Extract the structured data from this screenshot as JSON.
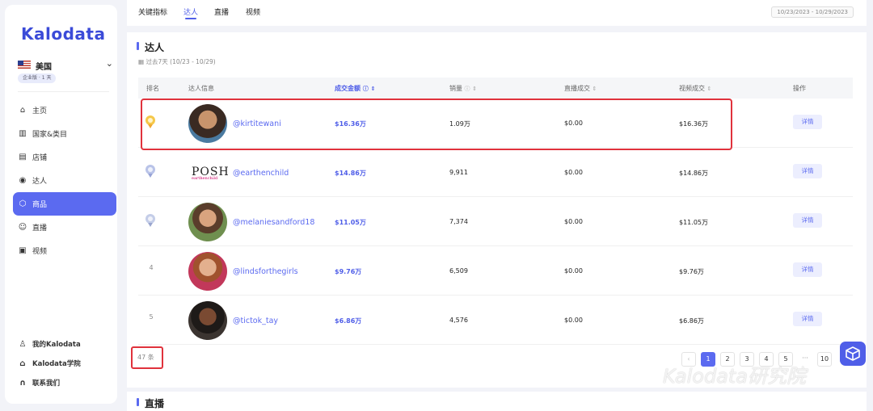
{
  "sidebar": {
    "logo": "Kalodata",
    "country": "美国",
    "plan": "企业版 · 1 天",
    "items": [
      {
        "label": "主页",
        "icon": "home-icon"
      },
      {
        "label": "国家&类目",
        "icon": "bank-icon"
      },
      {
        "label": "店铺",
        "icon": "store-icon"
      },
      {
        "label": "达人",
        "icon": "location-pin-icon"
      },
      {
        "label": "商品",
        "icon": "cube-icon"
      },
      {
        "label": "直播",
        "icon": "users-icon"
      },
      {
        "label": "视频",
        "icon": "video-icon"
      }
    ],
    "bottom": [
      {
        "label": "我的Kalodata",
        "icon": "user-icon"
      },
      {
        "label": "Kalodata学院",
        "icon": "graduation-cap-icon"
      },
      {
        "label": "联系我们",
        "icon": "headset-icon"
      }
    ]
  },
  "tabs": [
    "关键指标",
    "达人",
    "直播",
    "视频"
  ],
  "date_range": "10/23/2023 - 10/29/2023",
  "section": {
    "title": "达人",
    "subtitle": "过去7天 (10/23 - 10/29)"
  },
  "table": {
    "headers": [
      "排名",
      "达人信息",
      "成交金额",
      "销量",
      "直播成交",
      "视频成交",
      "操作"
    ],
    "detail_label": "详情",
    "rows": [
      {
        "rank": "1",
        "handle": "@kirtitewani",
        "gmv": "$16.36万",
        "sales": "1.09万",
        "live": "$0.00",
        "video": "$16.36万"
      },
      {
        "rank": "2",
        "handle": "@earthenchild",
        "gmv": "$14.86万",
        "sales": "9,911",
        "live": "$0.00",
        "video": "$14.86万"
      },
      {
        "rank": "3",
        "handle": "@melaniesandford18",
        "gmv": "$11.05万",
        "sales": "7,374",
        "live": "$0.00",
        "video": "$11.05万"
      },
      {
        "rank": "4",
        "handle": "@lindsforthegirls",
        "gmv": "$9.76万",
        "sales": "6,509",
        "live": "$0.00",
        "video": "$9.76万"
      },
      {
        "rank": "5",
        "handle": "@tictok_tay",
        "gmv": "$6.86万",
        "sales": "4,576",
        "live": "$0.00",
        "video": "$6.86万"
      }
    ]
  },
  "posh_logo": "POSH",
  "posh_logo_sub": "earthenchild",
  "total": "47 条",
  "pagination": {
    "pages": [
      "1",
      "2",
      "3",
      "4",
      "5",
      "···",
      "10"
    ],
    "current": "1"
  },
  "next_section_title": "直播",
  "watermark": "Kalodata研究院",
  "colors": {
    "accent": "#5b6af0",
    "highlight": "#e0323c"
  }
}
